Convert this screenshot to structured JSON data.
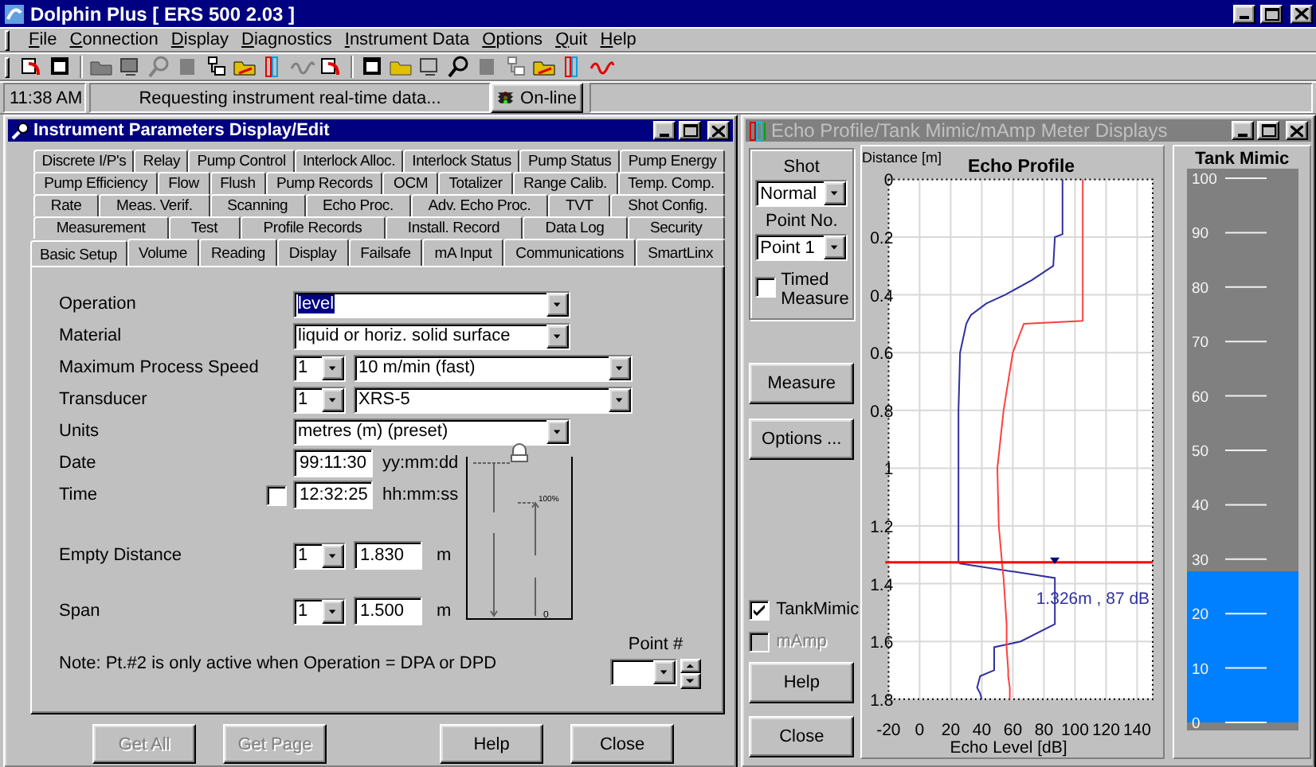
{
  "window": {
    "title": "Dolphin Plus [ ERS 500 2.03 ]"
  },
  "menu": [
    "File",
    "Connection",
    "Display",
    "Diagnostics",
    "Instrument Data",
    "Options",
    "Quit",
    "Help"
  ],
  "status_bar": {
    "time": "11:38 AM",
    "message": "Requesting instrument real-time data...",
    "connection": "On-line"
  },
  "parameters_window": {
    "title": "Instrument Parameters Display/Edit",
    "active": true,
    "tab_rows": [
      {
        "tabs": [
          {
            "label": "Discrete I/P's",
            "selected": false
          },
          {
            "label": "Relay",
            "selected": false
          },
          {
            "label": "Pump Control",
            "selected": false
          },
          {
            "label": "Interlock Alloc.",
            "selected": false
          },
          {
            "label": "Interlock Status",
            "selected": false
          },
          {
            "label": "Pump Status",
            "selected": false
          },
          {
            "label": "Pump Energy",
            "selected": false
          }
        ]
      },
      {
        "tabs": [
          {
            "label": "Pump Efficiency",
            "selected": false
          },
          {
            "label": "Flow",
            "selected": false
          },
          {
            "label": "Flush",
            "selected": false
          },
          {
            "label": "Pump Records",
            "selected": false
          },
          {
            "label": "OCM",
            "selected": false
          },
          {
            "label": "Totalizer",
            "selected": false
          },
          {
            "label": "Range Calib.",
            "selected": false
          },
          {
            "label": "Temp. Comp.",
            "selected": false
          }
        ]
      },
      {
        "tabs": [
          {
            "label": "Rate",
            "selected": false
          },
          {
            "label": "Meas. Verif.",
            "selected": false
          },
          {
            "label": "Scanning",
            "selected": false
          },
          {
            "label": "Echo Proc.",
            "selected": false
          },
          {
            "label": "Adv. Echo Proc.",
            "selected": false
          },
          {
            "label": "TVT",
            "selected": false
          },
          {
            "label": "Shot Config.",
            "selected": false
          }
        ]
      },
      {
        "tabs": [
          {
            "label": "Measurement",
            "selected": false
          },
          {
            "label": "Test",
            "selected": false
          },
          {
            "label": "Profile Records",
            "selected": false
          },
          {
            "label": "Install. Record",
            "selected": false
          },
          {
            "label": "Data Log",
            "selected": false
          },
          {
            "label": "Security",
            "selected": false
          }
        ]
      },
      {
        "tabs": [
          {
            "label": "Basic Setup",
            "selected": true
          },
          {
            "label": "Volume",
            "selected": false
          },
          {
            "label": "Reading",
            "selected": false
          },
          {
            "label": "Display",
            "selected": false
          },
          {
            "label": "Failsafe",
            "selected": false
          },
          {
            "label": "mA Input",
            "selected": false
          },
          {
            "label": "Communications",
            "selected": false
          },
          {
            "label": "SmartLinx",
            "selected": false
          }
        ]
      }
    ],
    "fields": [
      {
        "kind": "select",
        "label": "Operation",
        "value": "level",
        "highlighted": true
      },
      {
        "kind": "select",
        "label": "Material",
        "value": "liquid or horiz. solid surface",
        "highlighted": false
      },
      {
        "kind": "point-select",
        "label": "Maximum Process Speed",
        "point": "1",
        "value": "10  m/min (fast)",
        "highlighted": false
      },
      {
        "kind": "point-select",
        "label": "Transducer",
        "point": "1",
        "value": "XRS-5",
        "highlighted": false
      },
      {
        "kind": "select",
        "label": "Units",
        "value": "metres (m) (preset)",
        "highlighted": false
      }
    ],
    "date": {
      "label": "Date",
      "value": "99:11:30",
      "format": "yy:mm:dd"
    },
    "time": {
      "label": "Time",
      "value": "12:32:25",
      "format": "hh:mm:ss",
      "checked": false
    },
    "distances": [
      {
        "label": "Empty Distance",
        "point": "1",
        "value": "1.830",
        "unit": "m"
      },
      {
        "label": "Span",
        "point": "1",
        "value": "1.500",
        "unit": "m"
      }
    ],
    "diagram": {
      "full_label": "100%",
      "empty_label": "0"
    },
    "note": "Note: Pt.#2 is only active when Operation = DPA or DPD",
    "point_number": {
      "label": "Point #"
    },
    "buttons": [
      {
        "label": "Get All",
        "disabled": true
      },
      {
        "label": "Get Page",
        "disabled": true
      },
      {
        "label": "Help",
        "disabled": false
      },
      {
        "label": "Close",
        "disabled": false
      }
    ]
  },
  "echo_window": {
    "title": "Echo Profile/Tank Mimic/mAmp Meter Displays",
    "active": false,
    "shot": {
      "label": "Shot",
      "value": "Normal"
    },
    "point": {
      "label": "Point No.",
      "value": "Point 1"
    },
    "timed_measure": {
      "label": "Timed Measure",
      "checked": false
    },
    "actions": [
      {
        "label": "Measure"
      },
      {
        "label": "Options ..."
      }
    ],
    "toggles": [
      {
        "label": "TankMimic",
        "checked": true,
        "disabled": false
      },
      {
        "label": "mAmp",
        "checked": false,
        "disabled": true
      }
    ],
    "buttons": [
      {
        "label": "Help"
      },
      {
        "label": "Close"
      }
    ],
    "echo_profile": {
      "chart_data": {
        "type": "line",
        "orientation": "horizontal",
        "title": "Echo Profile",
        "xlabel": "Echo Level [dB]",
        "ylabel": "Distance [m]",
        "grid": true,
        "x": [
          0,
          0.19,
          0.2,
          0.3,
          0.35,
          0.4,
          0.43,
          0.47,
          0.49,
          0.5,
          0.6,
          0.8,
          1.0,
          1.2,
          1.326,
          1.33,
          1.38,
          1.54,
          1.6,
          1.62,
          1.7,
          1.72,
          1.76,
          1.78,
          1.8
        ],
        "series": [
          {
            "color": "#3030a0",
            "values": [
              92,
              92,
              87,
              86,
              72,
              55,
              43,
              33,
              31,
              30,
              26,
              25,
              25,
              25,
              25,
              26,
              87,
              87,
              65,
              48,
              48,
              39,
              37,
              39,
              40
            ]
          },
          {
            "color": "#ff4040",
            "values": [
              105,
              105,
              105,
              105,
              105,
              105,
              105,
              105,
              105,
              67,
              60,
              54,
              50,
              51,
              53,
              53,
              54,
              56,
              56,
              56,
              57,
              57,
              58,
              58,
              58
            ]
          }
        ],
        "xlim": [
          -20,
          150
        ],
        "ylim": [
          1.8,
          0
        ],
        "xticks": [
          -20,
          0,
          20,
          40,
          60,
          80,
          100,
          120,
          140
        ],
        "yticks": [
          0,
          0.2,
          0.4,
          0.6,
          0.8,
          1,
          1.2,
          1.4,
          1.6,
          1.8
        ],
        "ref_lines": [
          {
            "axis": "y",
            "value": 1.326,
            "color": "#ff0000"
          }
        ],
        "annotations": [
          "1.326m , 87 dB"
        ]
      }
    },
    "tank_mimic": {
      "title": "Tank Mimic",
      "level": 0.277,
      "ticks": [
        "100",
        "90",
        "80",
        "70",
        "60",
        "50",
        "40",
        "30",
        "20",
        "10",
        "0"
      ]
    }
  }
}
